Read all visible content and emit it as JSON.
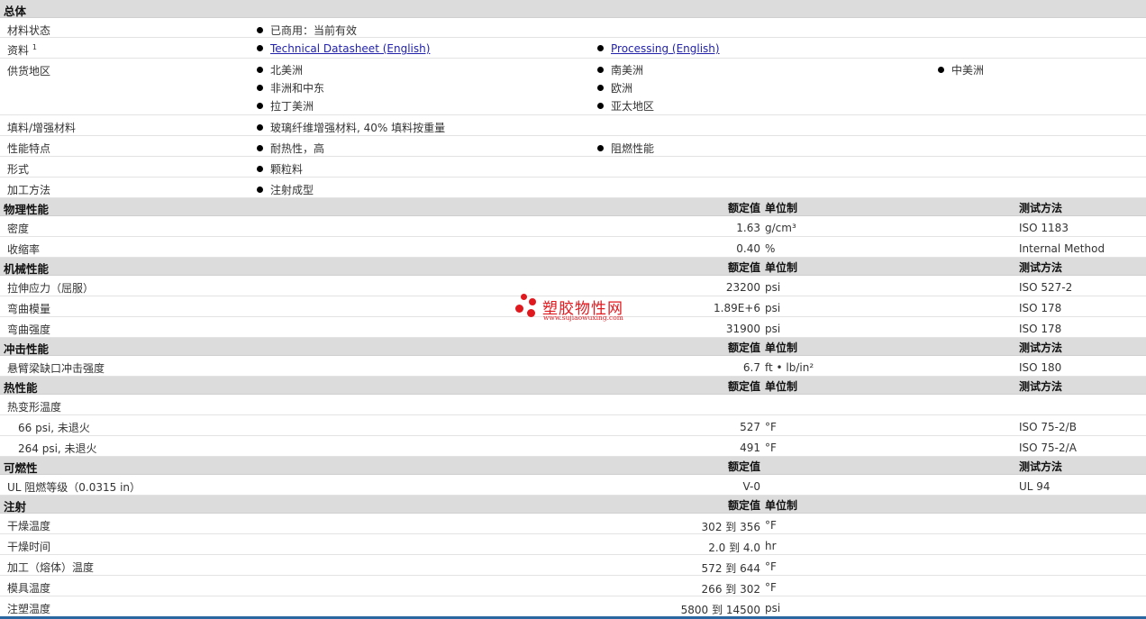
{
  "general": {
    "title": "总体",
    "status_label": "材料状态",
    "status_value": "已商用：当前有效",
    "docs_label": "资料",
    "docs_sup": "1",
    "docs": [
      "Technical Datasheet (English)",
      "Processing (English)"
    ],
    "region_label": "供货地区",
    "regions": [
      "北美洲",
      "南美洲",
      "中美洲",
      "非洲和中东",
      "欧洲",
      "拉丁美洲",
      "亚太地区"
    ],
    "filler_label": "填料/增强材料",
    "filler_value": "玻璃纤维增强材料, 40% 填料按重量",
    "features_label": "性能特点",
    "features": [
      "耐热性，高",
      "阻燃性能"
    ],
    "form_label": "形式",
    "form_value": "颗粒料",
    "method_label": "加工方法",
    "method_value": "注射成型"
  },
  "headers": {
    "rated": "额定值",
    "unit": "单位制",
    "test": "测试方法"
  },
  "physical": {
    "title": "物理性能",
    "rows": [
      {
        "label": "密度",
        "value": "1.63",
        "unit": "g/cm³",
        "test": "ISO 1183"
      },
      {
        "label": "收缩率",
        "value": "0.40",
        "unit": "%",
        "test": "Internal Method"
      }
    ]
  },
  "mechanical": {
    "title": "机械性能",
    "rows": [
      {
        "label": "拉伸应力（屈服）",
        "value": "23200",
        "unit": "psi",
        "test": "ISO 527-2"
      },
      {
        "label": "弯曲模量",
        "value": "1.89E+6",
        "unit": "psi",
        "test": "ISO 178"
      },
      {
        "label": "弯曲强度",
        "value": "31900",
        "unit": "psi",
        "test": "ISO 178"
      }
    ]
  },
  "impact": {
    "title": "冲击性能",
    "rows": [
      {
        "label": "悬臂梁缺口冲击强度",
        "value": "6.7",
        "unit": "ft • lb/in²",
        "test": "ISO 180"
      }
    ]
  },
  "thermal": {
    "title": "热性能",
    "rows": [
      {
        "label": "热变形温度",
        "value": "",
        "unit": "",
        "test": ""
      },
      {
        "label": "66 psi, 未退火",
        "value": "527",
        "unit": "°F",
        "test": "ISO 75-2/B"
      },
      {
        "label": "264 psi, 未退火",
        "value": "491",
        "unit": "°F",
        "test": "ISO 75-2/A"
      }
    ]
  },
  "flammability": {
    "title": "可燃性",
    "rows": [
      {
        "label": "UL 阻燃等级（0.0315 in）",
        "value": "V-0",
        "unit": "",
        "test": "UL 94"
      }
    ]
  },
  "injection": {
    "title": "注射",
    "rows": [
      {
        "label": "干燥温度",
        "value": "302 到  356",
        "unit": "°F"
      },
      {
        "label": "干燥时间",
        "value": "2.0 到  4.0",
        "unit": "hr"
      },
      {
        "label": "加工（熔体）温度",
        "value": "572 到  644",
        "unit": "°F"
      },
      {
        "label": "模具温度",
        "value": "266 到  302",
        "unit": "°F"
      },
      {
        "label": "注塑温度",
        "value": "5800 到  14500",
        "unit": "psi"
      }
    ]
  },
  "watermark": {
    "name": "塑胶物性网",
    "url": "www.sujiaowuxing.com"
  },
  "colors": {
    "section_bg": "#dcdcdc",
    "link": "#2222aa",
    "watermark": "#e0191f",
    "bottom_bar": "#2a67a0"
  }
}
